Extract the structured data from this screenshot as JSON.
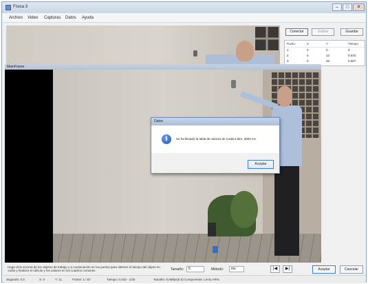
{
  "window": {
    "title": "Física 3",
    "controls": {
      "minimize": "–",
      "maximize": "□",
      "close": "✕"
    }
  },
  "menu": [
    "Archivo",
    "Video",
    "Capturas",
    "Datos",
    "Ayuda"
  ],
  "right_panel": {
    "buttons": [
      "Conectar",
      "Grabar",
      "Guardar"
    ],
    "table": {
      "columns": [
        "Punto",
        "X",
        "Y",
        "Tiempo"
      ],
      "rows": [
        [
          "1",
          "0",
          "0",
          "0"
        ],
        [
          "2",
          "0",
          "12",
          "0.033"
        ],
        [
          "3",
          "0",
          "45",
          "0.067"
        ]
      ]
    }
  },
  "main_frame": {
    "title": "MainFrame"
  },
  "dialog": {
    "title": "Datos",
    "message": "Se ha llenado la tabla de valores de Caída Libre. 3000 ms",
    "ok_label": "Aceptar",
    "icon": "info-icon"
  },
  "bottom": {
    "instructions": "Haga click encima de los objetos de trabajo y a continuación en los puntos para obtener el tiempo del objeto en caída y finalizar el cálculo y los valores en los cuadros comunes",
    "tamano_label": "Tamaño:",
    "tamano_value": "5",
    "metodo_label": "Método:",
    "metodo_value": "ms",
    "nav_prev": "|◀",
    "nav_next": "▶|",
    "buttons": [
      "Aceptar",
      "Cancelar"
    ]
  },
  "status": {
    "items": [
      "Segundo: 0.0",
      "X: 0",
      "Y: 11",
      "Frame: 1 / 67",
      "Tiempo: 0.033 - 1/30",
      "Tamaño: 0,0Mfps(0,0) Componente: Lento AR%"
    ]
  }
}
